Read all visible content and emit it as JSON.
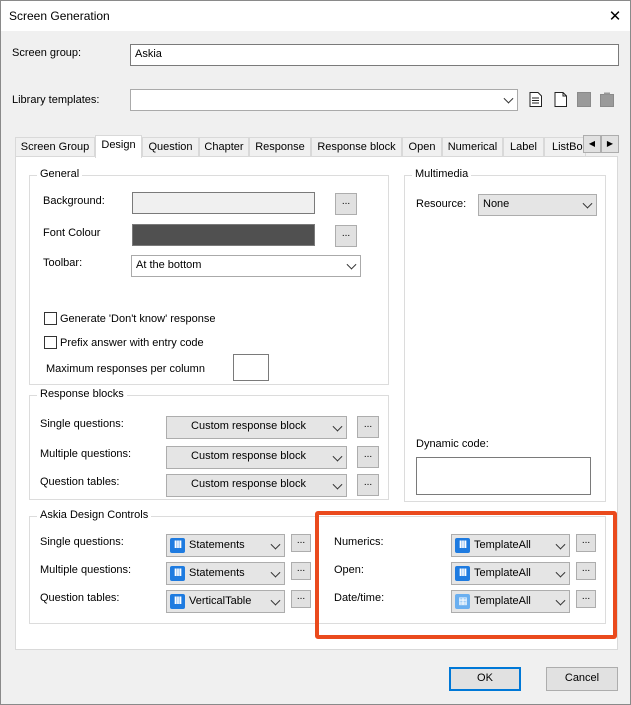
{
  "window": {
    "title": "Screen Generation"
  },
  "screen_group": {
    "label": "Screen group:",
    "value": "Askia"
  },
  "library_templates": {
    "label": "Library templates:",
    "value": ""
  },
  "tabs": [
    {
      "label": "Screen Group"
    },
    {
      "label": "Design"
    },
    {
      "label": "Question"
    },
    {
      "label": "Chapter"
    },
    {
      "label": "Response"
    },
    {
      "label": "Response block"
    },
    {
      "label": "Open"
    },
    {
      "label": "Numerical"
    },
    {
      "label": "Label"
    },
    {
      "label": "ListBo"
    }
  ],
  "general": {
    "title": "General",
    "background_label": "Background:",
    "font_colour_label": "Font Colour",
    "font_colour": "#505050",
    "toolbar_label": "Toolbar:",
    "toolbar_value": "At the bottom",
    "dont_know_label": "Generate 'Don't know' response",
    "prefix_label": "Prefix answer with entry code",
    "max_responses_label": "Maximum responses per column",
    "ellipsis": "..."
  },
  "multimedia": {
    "title": "Multimedia",
    "resource_label": "Resource:",
    "resource_value": "None",
    "dynamic_code_label": "Dynamic code:"
  },
  "response_blocks": {
    "title": "Response blocks",
    "rows": [
      {
        "label": "Single questions:",
        "value": "Custom response block"
      },
      {
        "label": "Multiple questions:",
        "value": "Custom response block"
      },
      {
        "label": "Question tables:",
        "value": "Custom response block"
      }
    ]
  },
  "adc": {
    "title": "Askia Design Controls",
    "left": [
      {
        "label": "Single questions:",
        "value": "Statements",
        "icon": "adc-bars-icon"
      },
      {
        "label": "Multiple questions:",
        "value": "Statements",
        "icon": "adc-bars-icon"
      },
      {
        "label": "Question tables:",
        "value": "VerticalTable",
        "icon": "adc-bars-icon"
      }
    ],
    "right": [
      {
        "label": "Numerics:",
        "value": "TemplateAll",
        "icon": "adc-bars-icon"
      },
      {
        "label": "Open:",
        "value": "TemplateAll",
        "icon": "adc-bars-icon"
      },
      {
        "label": "Date/time:",
        "value": "TemplateAll",
        "icon": "adc-grid-icon"
      }
    ],
    "highlight_color": "#ea4a1d"
  },
  "buttons": {
    "ok": "OK",
    "cancel": "Cancel"
  }
}
